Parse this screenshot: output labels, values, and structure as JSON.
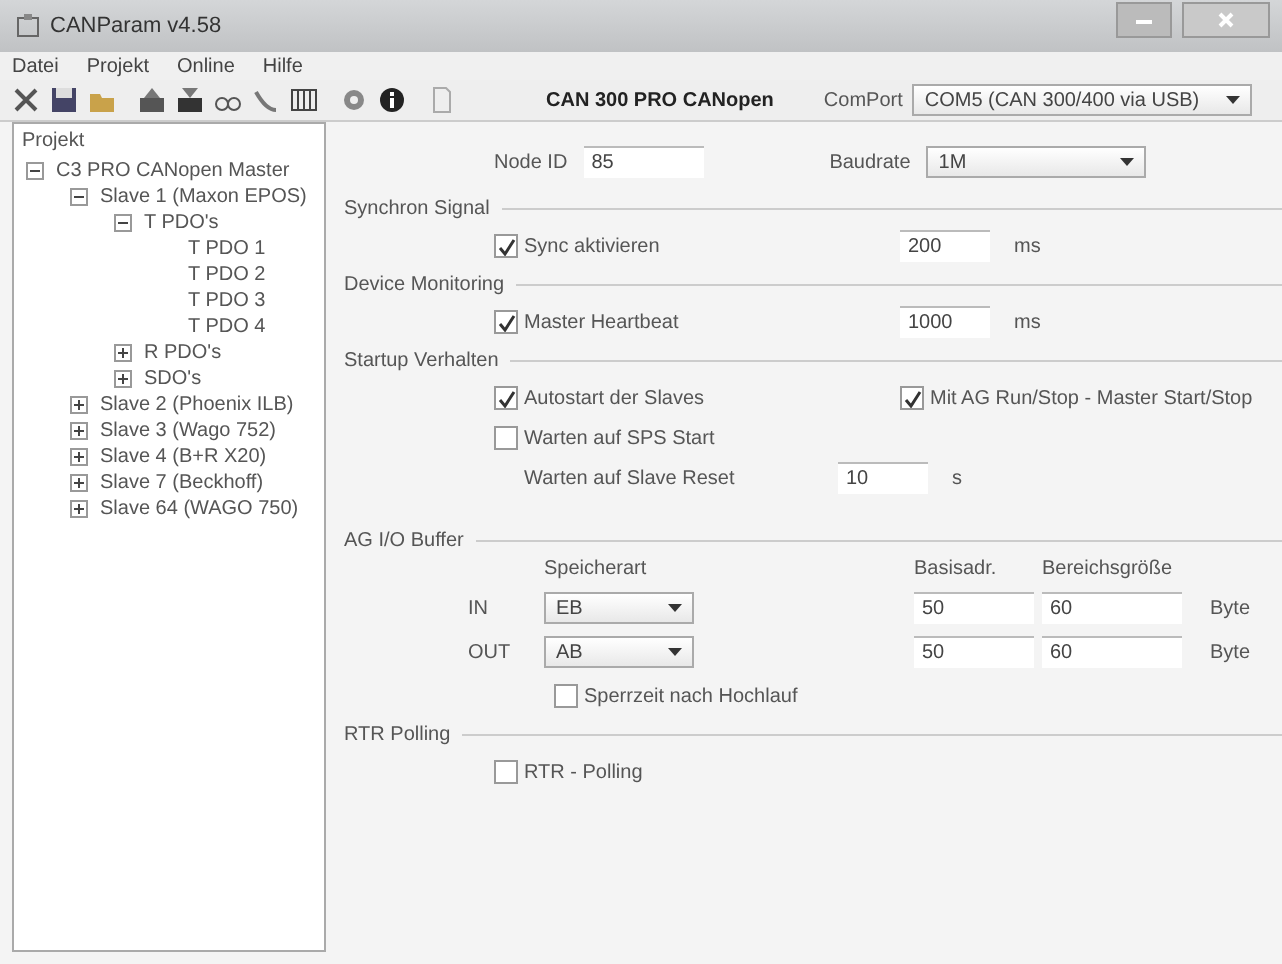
{
  "window": {
    "title": "CANParam v4.58"
  },
  "menu": [
    "Datei",
    "Projekt",
    "Online",
    "Hilfe"
  ],
  "toolbar": {
    "device": "CAN 300 PRO CANopen",
    "comport_label": "ComPort",
    "comport": "COM5 (CAN 300/400 via USB)"
  },
  "tree": {
    "header": "Projekt",
    "items": [
      {
        "label": "C3 PRO CANopen Master",
        "expanded": true,
        "children": [
          {
            "label": "Slave 1 (Maxon EPOS)",
            "expanded": true,
            "children": [
              {
                "label": "T PDO's",
                "expanded": true,
                "children": [
                  {
                    "label": "T PDO 1"
                  },
                  {
                    "label": "T PDO 2"
                  },
                  {
                    "label": "T PDO 3"
                  },
                  {
                    "label": "T PDO 4"
                  }
                ]
              },
              {
                "label": "R PDO's",
                "expanded": false
              },
              {
                "label": "SDO's",
                "expanded": false
              }
            ]
          },
          {
            "label": "Slave 2 (Phoenix ILB)",
            "expanded": false
          },
          {
            "label": "Slave 3 (Wago 752)",
            "expanded": false
          },
          {
            "label": "Slave 4 (B+R X20)",
            "expanded": false
          },
          {
            "label": "Slave 7 (Beckhoff)",
            "expanded": false
          },
          {
            "label": "Slave 64 (WAGO 750)",
            "expanded": false
          }
        ]
      }
    ]
  },
  "form": {
    "node_id_label": "Node ID",
    "node_id": "85",
    "baudrate_label": "Baudrate",
    "baudrate": "1M",
    "timed_sections": [
      {
        "title": "Synchron Signal",
        "checkbox": {
          "label": "Sync aktivieren",
          "checked": true
        },
        "value": "200",
        "unit": "ms"
      },
      {
        "title": "Device Monitoring",
        "checkbox": {
          "label": "Master Heartbeat",
          "checked": true
        },
        "value": "1000",
        "unit": "ms"
      }
    ],
    "startup": {
      "title": "Startup Verhalten",
      "autostart": {
        "label": "Autostart der Slaves",
        "checked": true
      },
      "run_stop": {
        "label": "Mit AG Run/Stop - Master Start/Stop",
        "checked": true
      },
      "wait_sps": {
        "label": "Warten auf SPS Start",
        "checked": false
      },
      "reset_label": "Warten auf Slave Reset",
      "reset_value": "10",
      "reset_unit": "s"
    },
    "buffer": {
      "title": "AG I/O Buffer",
      "columns": [
        "Speicherart",
        "Basisadr.",
        "Bereichsgröße"
      ],
      "rows": [
        {
          "label": "IN",
          "type": "EB",
          "base": "50",
          "size": "60",
          "unit": "Byte"
        },
        {
          "label": "OUT",
          "type": "AB",
          "base": "50",
          "size": "60",
          "unit": "Byte"
        }
      ],
      "lock": {
        "label": "Sperrzeit nach Hochlauf",
        "checked": false
      }
    },
    "rtr": {
      "title": "RTR Polling",
      "checkbox": {
        "label": "RTR - Polling",
        "checked": false
      }
    }
  }
}
